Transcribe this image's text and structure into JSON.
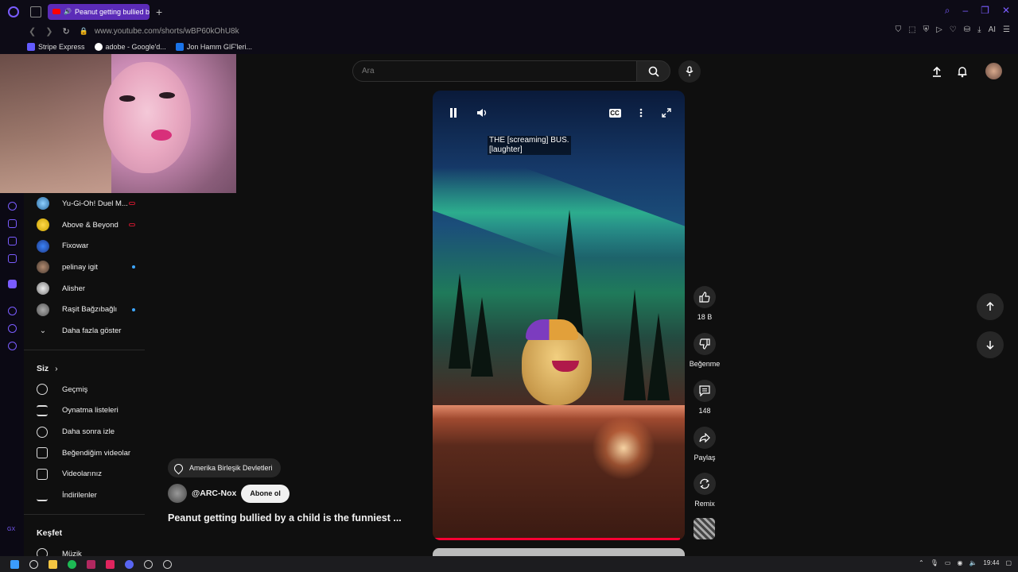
{
  "browser": {
    "tab_title": "Peanut getting bullied b",
    "new_tab": "+",
    "url": "www.youtube.com/shorts/wBP60kOhU8k",
    "bookmarks": [
      "Stripe Express",
      "adobe - Google'd...",
      "Jon Hamm GIF'leri..."
    ],
    "ai_label": "AI"
  },
  "search": {
    "placeholder": "Ara"
  },
  "sidebar": {
    "channels": [
      {
        "name": "Yu-Gi-Oh! Duel M...",
        "status": "live"
      },
      {
        "name": "Above & Beyond",
        "status": "live"
      },
      {
        "name": "Fixowar",
        "status": ""
      },
      {
        "name": "pelinay igit",
        "status": "new"
      },
      {
        "name": "Alisher",
        "status": ""
      },
      {
        "name": "Raşit Bağzıbağlı",
        "status": "new"
      }
    ],
    "show_more": "Daha fazla göster",
    "you_title": "Siz",
    "you_items": [
      "Geçmiş",
      "Oynatma listeleri",
      "Daha sonra izle",
      "Beğendiğim videolar",
      "Videolarınız",
      "İndirilenler"
    ],
    "explore_title": "Keşfet",
    "explore_items": [
      "Müzik"
    ]
  },
  "video": {
    "caption_line1": "THE [screaming] BUS.",
    "caption_line2": "[laughter]",
    "cc_label": "CC",
    "progress": 0.98
  },
  "actions": {
    "likes": "18 B",
    "dislike_label": "Beğenme",
    "comments": "148",
    "share_label": "Paylaş",
    "remix_label": "Remix"
  },
  "info": {
    "location": "Amerika Birleşik Devletleri",
    "channel": "@ARC-Nox",
    "subscribe": "Abone ol",
    "title": "Peanut getting bullied by a child is the funniest ..."
  },
  "taskbar": {
    "time": "19:44"
  },
  "colors": {
    "accent": "#7a5cff",
    "progress": "#ff0033",
    "live": "#c0172c",
    "new_dot": "#3ea6ff"
  }
}
